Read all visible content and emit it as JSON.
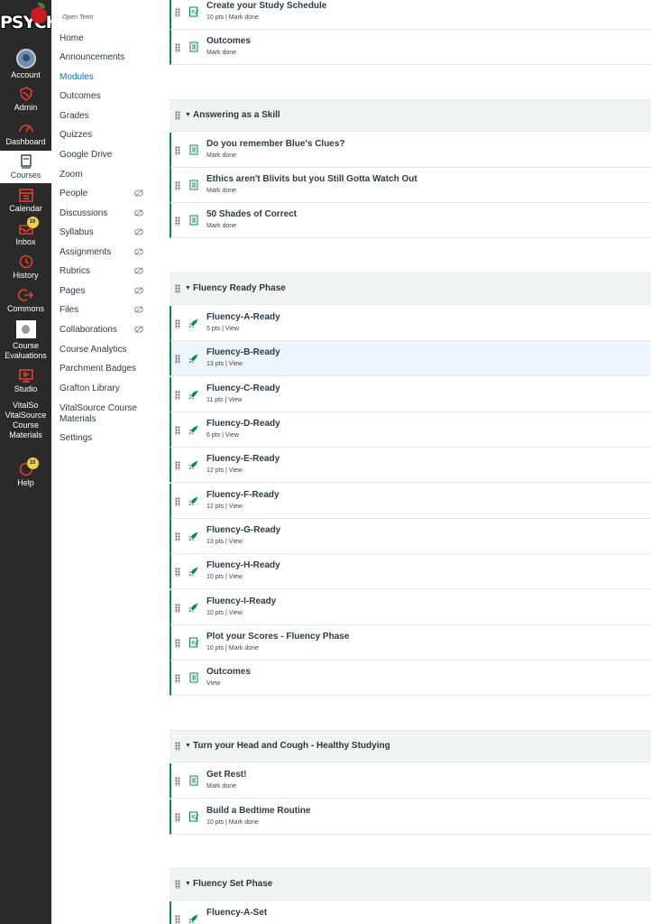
{
  "global_nav": {
    "logo_text": "PSYCH",
    "items": [
      {
        "label": "Account",
        "icon": "avatar"
      },
      {
        "label": "Admin",
        "icon": "shield-icon"
      },
      {
        "label": "Dashboard",
        "icon": "dashboard-icon"
      },
      {
        "label": "Courses",
        "icon": "courses-icon"
      },
      {
        "label": "Calendar",
        "icon": "calendar-icon"
      },
      {
        "label": "Inbox",
        "icon": "inbox-icon",
        "badge": "10"
      },
      {
        "label": "History",
        "icon": "clock-icon"
      },
      {
        "label": "Commons",
        "icon": "commons-icon"
      },
      {
        "label": "Course Evaluations",
        "icon": "evaluations-icon"
      },
      {
        "label": "Studio",
        "icon": "studio-icon"
      },
      {
        "label": "VitalSource Course Materials",
        "icon": "vitalsource-icon",
        "alt": "VitalSo"
      },
      {
        "label": "Help",
        "icon": "help-icon",
        "badge": "10"
      }
    ]
  },
  "course_nav": {
    "term": "Open Term",
    "items": [
      {
        "label": "Home"
      },
      {
        "label": "Announcements"
      },
      {
        "label": "Modules"
      },
      {
        "label": "Outcomes"
      },
      {
        "label": "Grades"
      },
      {
        "label": "Quizzes"
      },
      {
        "label": "Google Drive"
      },
      {
        "label": "Zoom"
      },
      {
        "label": "People"
      },
      {
        "label": "Discussions"
      },
      {
        "label": "Syllabus"
      },
      {
        "label": "Assignments"
      },
      {
        "label": "Rubrics"
      },
      {
        "label": "Pages"
      },
      {
        "label": "Files"
      },
      {
        "label": "Collaborations"
      },
      {
        "label": "Course Analytics"
      },
      {
        "label": "Parchment Badges"
      },
      {
        "label": "Grafton Library"
      },
      {
        "label": "VitalSource Course Materials"
      },
      {
        "label": "Settings"
      }
    ]
  },
  "modules": {
    "m0": {
      "items": [
        {
          "title": "Create your Study Schedule",
          "meta": "10 pts  |  Mark done"
        },
        {
          "title": "Outcomes",
          "meta": "Mark done"
        }
      ]
    },
    "m1": {
      "title": "Answering as a Skill",
      "items": [
        {
          "title": "Do you remember Blue's Clues?",
          "meta": "Mark done"
        },
        {
          "title": "Ethics aren't Blivits but you Still Gotta Watch Out",
          "meta": "Mark done"
        },
        {
          "title": "50 Shades of Correct",
          "meta": "Mark done"
        }
      ]
    },
    "m2": {
      "title": "Fluency Ready Phase",
      "items": [
        {
          "title": "Fluency-A-Ready",
          "meta": "5 pts  |  View"
        },
        {
          "title": "Fluency-B-Ready",
          "meta": "13 pts  |  View"
        },
        {
          "title": "Fluency-C-Ready",
          "meta": "11 pts  |  View"
        },
        {
          "title": "Fluency-D-Ready",
          "meta": "6 pts  |  View"
        },
        {
          "title": "Fluency-E-Ready",
          "meta": "12 pts  |  View"
        },
        {
          "title": "Fluency-F-Ready",
          "meta": "12 pts  |  View"
        },
        {
          "title": "Fluency-G-Ready",
          "meta": "13 pts  |  View"
        },
        {
          "title": "Fluency-H-Ready",
          "meta": "10 pts  |  View"
        },
        {
          "title": "Fluency-I-Ready",
          "meta": "10 pts  |  View"
        },
        {
          "title": "Plot your Scores - Fluency Phase",
          "meta": "10 pts  |  Mark done"
        },
        {
          "title": "Outcomes",
          "meta": "View"
        }
      ]
    },
    "m3": {
      "title": "Turn your Head and Cough - Healthy Studying",
      "items": [
        {
          "title": "Get Rest!",
          "meta": "Mark done"
        },
        {
          "title": "Build a Bedtime Routine",
          "meta": "10 pts  |  Mark done"
        }
      ]
    },
    "m4": {
      "title": "Fluency Set Phase",
      "items": [
        {
          "title": "Fluency-A-Set",
          "meta": ""
        }
      ]
    }
  },
  "colors": {
    "nav_bg": "#2a2a2a",
    "accent": "#0374b5",
    "module_border": "#0b874b",
    "nav_icon": "#e03e2d"
  }
}
